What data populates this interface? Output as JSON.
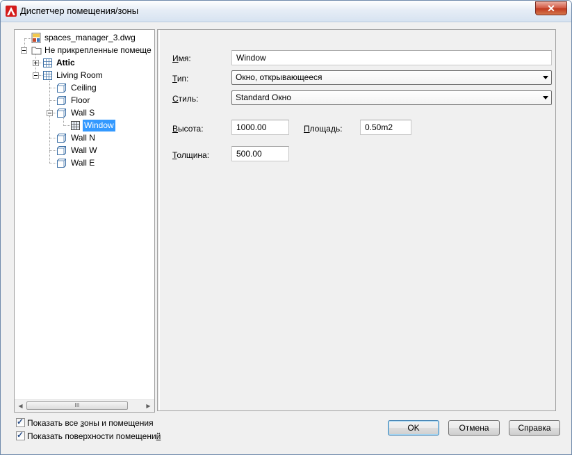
{
  "window": {
    "title": "Диспетчер помещения/зоны",
    "close_label": "✕"
  },
  "tree": {
    "items": [
      {
        "label": "spaces_manager_3.dwg",
        "icon": "dwg-file-icon"
      },
      {
        "label": "Не прикрепленные помеще",
        "icon": "folder-icon",
        "expanded": true
      },
      {
        "label": "Attic",
        "icon": "zone-icon",
        "bold": true,
        "expanded": false
      },
      {
        "label": "Living Room",
        "icon": "zone-icon",
        "expanded": true
      },
      {
        "label": "Ceiling",
        "icon": "surface-icon"
      },
      {
        "label": "Floor",
        "icon": "surface-icon"
      },
      {
        "label": "Wall S",
        "icon": "surface-icon",
        "expanded": true
      },
      {
        "label": "Window",
        "icon": "window-opening-icon",
        "selected": true
      },
      {
        "label": "Wall N",
        "icon": "surface-icon"
      },
      {
        "label": "Wall W",
        "icon": "surface-icon"
      },
      {
        "label": "Wall E",
        "icon": "surface-icon"
      }
    ],
    "scroll_thumb_glyph": "III"
  },
  "properties": {
    "name": {
      "label_u": "И",
      "label_rest": "мя:",
      "value": "Window"
    },
    "type": {
      "label_u": "Т",
      "label_rest": "ип:",
      "value": "Окно, открывающееся"
    },
    "style": {
      "label_u": "С",
      "label_rest": "тиль:",
      "value": "Standard Окно"
    },
    "height": {
      "label_u": "В",
      "label_rest": "ысота:",
      "value": "1000.00"
    },
    "area": {
      "label_u": "П",
      "label_rest": "лощадь:",
      "value": "0.50m2"
    },
    "thickness": {
      "label_u": "Т",
      "label_rest": "олщина:",
      "value": "500.00"
    }
  },
  "options": {
    "show_all": {
      "label_pre": "Показать все ",
      "label_u": "з",
      "label_post": "оны и помещения",
      "checked": true
    },
    "show_surfaces": {
      "label_pre": "Показать поверхности помещени",
      "label_u": "й",
      "label_post": "",
      "checked": true
    }
  },
  "buttons": {
    "ok": "OK",
    "cancel": "Отмена",
    "help": "Справка"
  }
}
